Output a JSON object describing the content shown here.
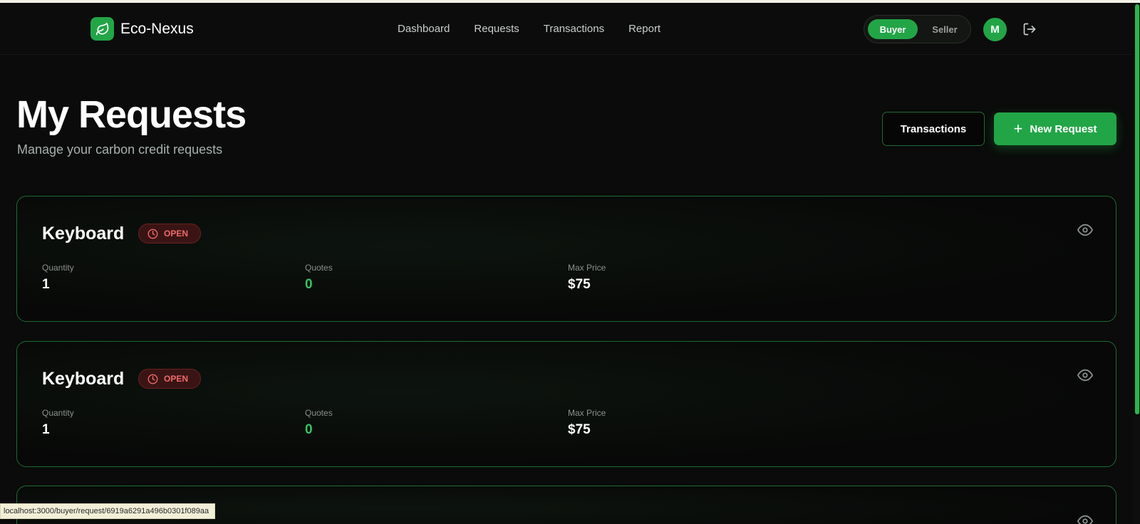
{
  "app": {
    "name": "Eco-Nexus"
  },
  "nav": [
    {
      "label": "Dashboard"
    },
    {
      "label": "Requests"
    },
    {
      "label": "Transactions"
    },
    {
      "label": "Report"
    }
  ],
  "role_toggle": {
    "buyer": "Buyer",
    "seller": "Seller",
    "selected": "Buyer"
  },
  "user": {
    "avatar_initial": "M"
  },
  "page": {
    "title": "My Requests",
    "subtitle": "Manage your carbon credit requests",
    "transactions_button": "Transactions",
    "new_request_button": "New Request"
  },
  "requests": [
    {
      "title": "Keyboard",
      "status": "OPEN",
      "stats": [
        {
          "label": "Quantity",
          "value": "1"
        },
        {
          "label": "Quotes",
          "value": "0"
        },
        {
          "label": "Max Price",
          "value": "$75"
        }
      ]
    },
    {
      "title": "Keyboard",
      "status": "OPEN",
      "stats": [
        {
          "label": "Quantity",
          "value": "1"
        },
        {
          "label": "Quotes",
          "value": "0"
        },
        {
          "label": "Max Price",
          "value": "$75"
        }
      ]
    }
  ],
  "status_bar": {
    "url": "localhost:3000/buyer/request/6919a6291a496b0301f089aa"
  },
  "icons": {
    "brand": "leaf-icon",
    "logout": "logout-icon",
    "status": "clock-icon",
    "view": "eye-icon",
    "add": "plus-icon"
  },
  "colors": {
    "accent": "#22a547",
    "background": "#0a0b0a",
    "card_border": "#1e6a32",
    "status_open": "#f06a6a",
    "quotes_value": "#38c463"
  }
}
